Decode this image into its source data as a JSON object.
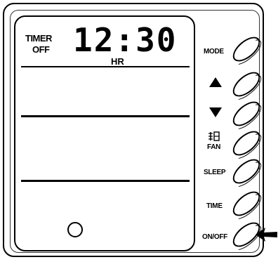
{
  "display": {
    "timer_word": "TIMER",
    "timer_state": "OFF",
    "clock": "12:30",
    "unit": "HR"
  },
  "buttons": {
    "mode": "MODE",
    "up": "up-arrow-icon",
    "down": "down-arrow-icon",
    "fan": "FAN",
    "sleep": "SLEEP",
    "time": "TIME",
    "onoff": "ON/OFF"
  }
}
